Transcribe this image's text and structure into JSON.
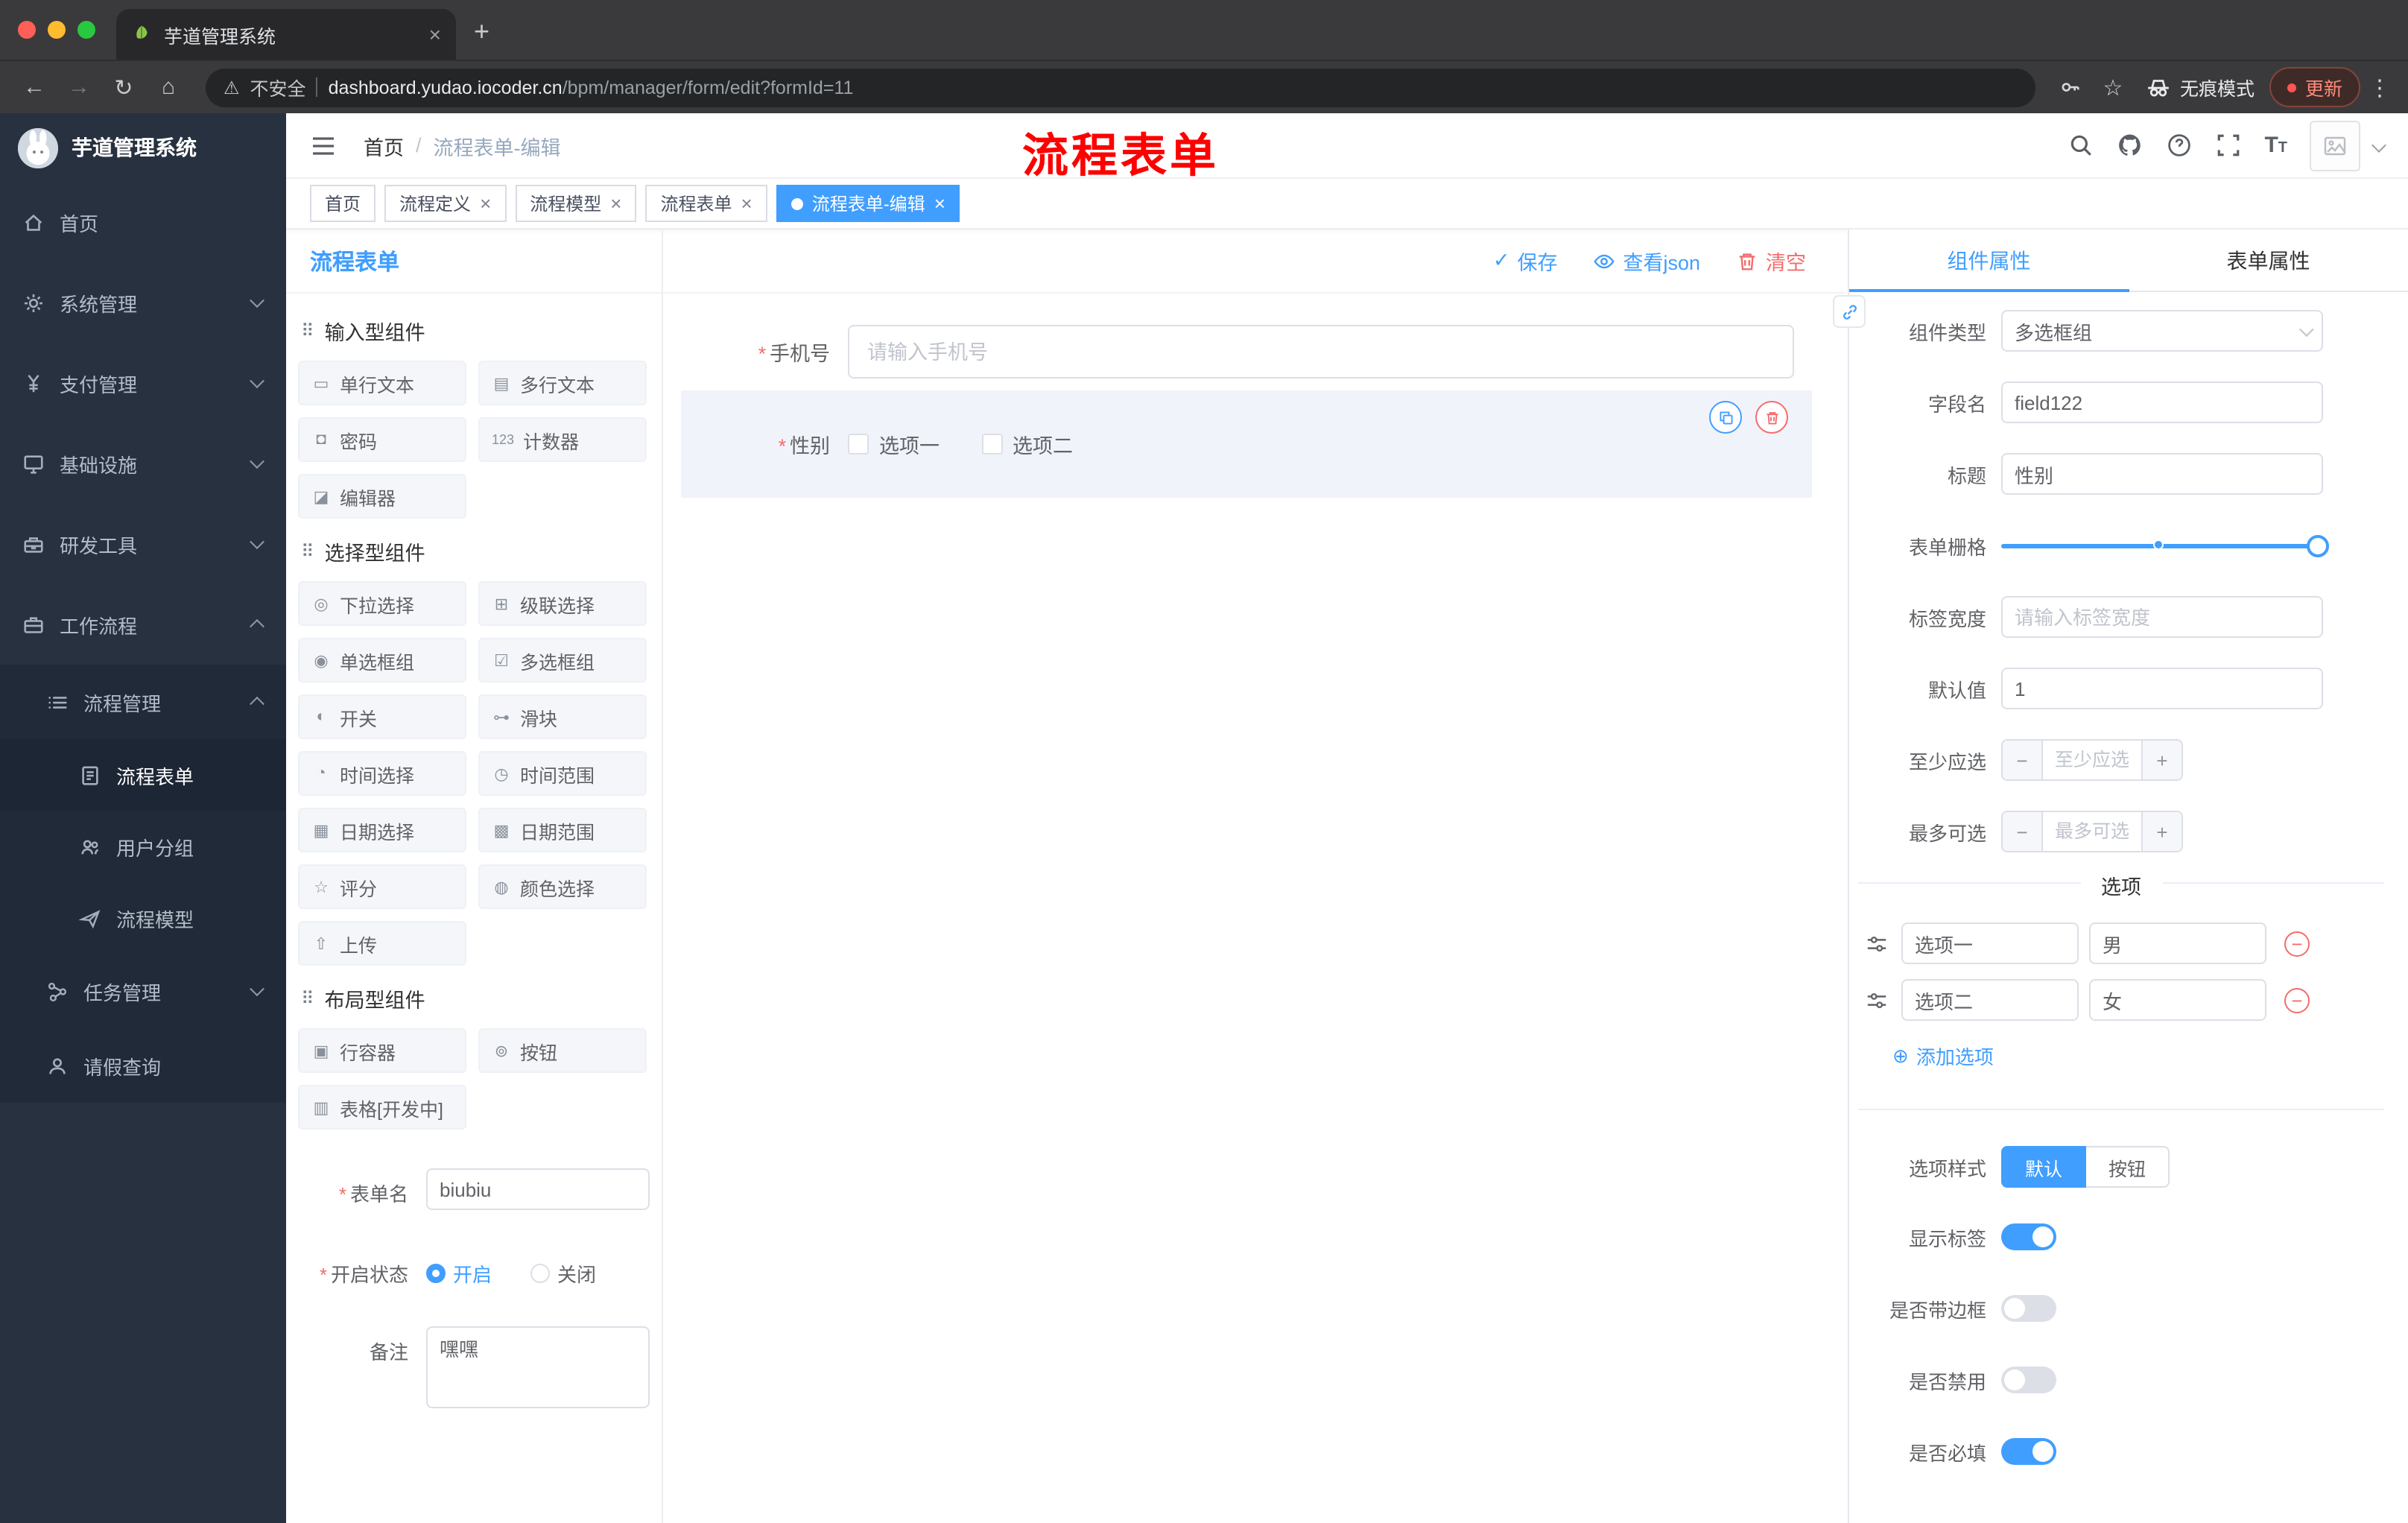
{
  "ui": {
    "close_glyph": "×",
    "plus_glyph": "+",
    "required_mark": "*",
    "check_glyph": "✓",
    "minus_glyph": "−",
    "add_glyph": "⊕",
    "section_drag_glyph": "⠿",
    "slash": "/",
    "kebab_glyph": "⋮",
    "back_glyph": "←",
    "forward_glyph": "→",
    "reload_glyph": "↻",
    "home_glyph": "⌂",
    "warn_glyph": "⚠",
    "star_glyph": "☆",
    "font_size_large": "T",
    "font_size_small": "T"
  },
  "browser": {
    "tab_title": "芋道管理系统",
    "security_label": "不安全",
    "url_host": "dashboard.yudao.iocoder.cn",
    "url_path": "/bpm/manager/form/edit?formId=11",
    "incognito_label": "无痕模式",
    "update_label": "更新"
  },
  "sidebar": {
    "app_title": "芋道管理系统",
    "items": [
      {
        "label": "首页"
      },
      {
        "label": "系统管理"
      },
      {
        "label": "支付管理"
      },
      {
        "label": "基础设施"
      },
      {
        "label": "研发工具"
      },
      {
        "label": "工作流程"
      },
      {
        "label": "流程管理"
      },
      {
        "label": "流程表单"
      },
      {
        "label": "用户分组"
      },
      {
        "label": "流程模型"
      },
      {
        "label": "任务管理"
      },
      {
        "label": "请假查询"
      }
    ]
  },
  "header": {
    "breadcrumb_home": "首页",
    "breadcrumb_current": "流程表单-编辑",
    "annotation": "流程表单"
  },
  "tags": [
    {
      "label": "首页"
    },
    {
      "label": "流程定义"
    },
    {
      "label": "流程模型"
    },
    {
      "label": "流程表单"
    },
    {
      "label": "流程表单-编辑"
    }
  ],
  "designer": {
    "title": "流程表单",
    "actions": {
      "save": "保存",
      "view_json": "查看json",
      "clear": "清空"
    }
  },
  "palette": {
    "sections": [
      {
        "title": "输入型组件",
        "items": [
          {
            "icon": "▭",
            "label": "单行文本"
          },
          {
            "icon": "▤",
            "label": "多行文本"
          },
          {
            "icon": "◘",
            "label": "密码"
          },
          {
            "icon": "123",
            "label": "计数器"
          },
          {
            "icon": "◪",
            "label": "编辑器"
          }
        ]
      },
      {
        "title": "选择型组件",
        "items": [
          {
            "icon": "◎",
            "label": "下拉选择"
          },
          {
            "icon": "⊞",
            "label": "级联选择"
          },
          {
            "icon": "◉",
            "label": "单选框组"
          },
          {
            "icon": "☑",
            "label": "多选框组"
          },
          {
            "icon": "◐",
            "label": "开关"
          },
          {
            "icon": "⊶",
            "label": "滑块"
          },
          {
            "icon": "◔",
            "label": "时间选择"
          },
          {
            "icon": "◷",
            "label": "时间范围"
          },
          {
            "icon": "▦",
            "label": "日期选择"
          },
          {
            "icon": "▩",
            "label": "日期范围"
          },
          {
            "icon": "☆",
            "label": "评分"
          },
          {
            "icon": "◍",
            "label": "颜色选择"
          },
          {
            "icon": "⇧",
            "label": "上传"
          }
        ]
      },
      {
        "title": "布局型组件",
        "items": [
          {
            "icon": "▣",
            "label": "行容器"
          },
          {
            "icon": "⊚",
            "label": "按钮"
          },
          {
            "icon": "▥",
            "label": "表格[开发中]"
          }
        ]
      }
    ]
  },
  "form_meta": {
    "name_label": "表单名",
    "name_value": "biubiu",
    "status_label": "开启状态",
    "status_options": [
      "开启",
      "关闭"
    ],
    "remark_label": "备注",
    "remark_value": "嘿嘿"
  },
  "canvas": {
    "fields": [
      {
        "label": "手机号",
        "placeholder": "请输入手机号"
      },
      {
        "label": "性别",
        "options": [
          "选项一",
          "选项二"
        ]
      }
    ]
  },
  "properties": {
    "tabs": [
      "组件属性",
      "表单属性"
    ],
    "fields": {
      "component_type_label": "组件类型",
      "component_type_value": "多选框组",
      "field_name_label": "字段名",
      "field_name_value": "field122",
      "title_label": "标题",
      "title_value": "性别",
      "grid_label": "表单栅格",
      "label_width_label": "标签宽度",
      "label_width_placeholder": "请输入标签宽度",
      "default_label": "默认值",
      "default_value": "1",
      "min_label": "至少应选",
      "min_placeholder": "至少应选",
      "max_label": "最多可选",
      "max_placeholder": "最多可选"
    },
    "options_section": {
      "title": "选项",
      "rows": [
        {
          "label": "选项一",
          "value": "男"
        },
        {
          "label": "选项二",
          "value": "女"
        }
      ],
      "add_label": "添加选项"
    },
    "style_section": {
      "label": "选项样式",
      "options": [
        "默认",
        "按钮"
      ]
    },
    "toggles": [
      {
        "label": "显示标签",
        "on": true
      },
      {
        "label": "是否带边框",
        "on": false
      },
      {
        "label": "是否禁用",
        "on": false
      },
      {
        "label": "是否必填",
        "on": true
      }
    ]
  },
  "colors": {
    "accent": "#409eff",
    "danger": "#f56c6c",
    "annotation": "#fd0000"
  }
}
